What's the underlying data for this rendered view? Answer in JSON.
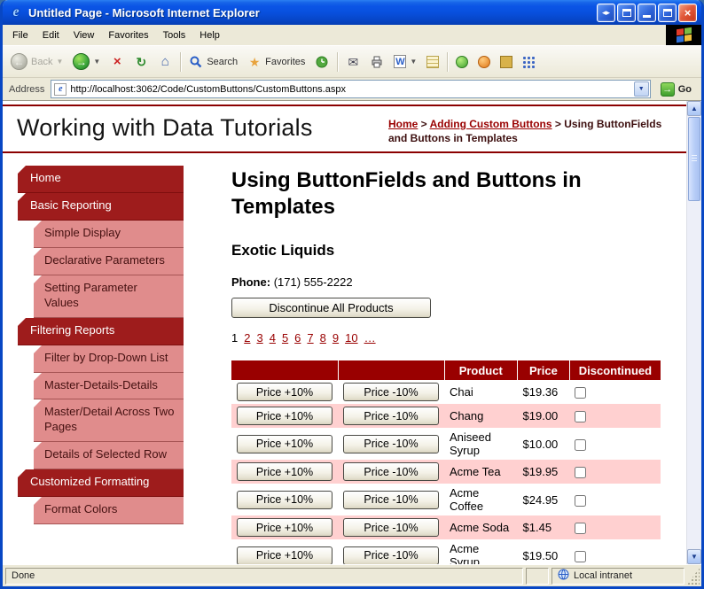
{
  "colors": {
    "maroon": "#990000",
    "nav_top_bg": "#9E1C1C",
    "nav_sub_bg": "#E08C8C",
    "row_alt": "#FFD0D0"
  },
  "window": {
    "title": "Untitled Page - Microsoft Internet Explorer",
    "menu": [
      "File",
      "Edit",
      "View",
      "Favorites",
      "Tools",
      "Help"
    ],
    "toolbar": {
      "back_label": "Back",
      "search_label": "Search",
      "favorites_label": "Favorites"
    },
    "address_label": "Address",
    "address_value": "http://localhost:3062/Code/CustomButtons/CustomButtons.aspx",
    "go_label": "Go",
    "status_left": "Done",
    "status_right": "Local intranet"
  },
  "page": {
    "site_title": "Working with Data Tutorials",
    "breadcrumb": [
      {
        "label": "Home",
        "link": true
      },
      {
        "label": "Adding Custom Buttons",
        "link": true
      },
      {
        "label": "Using ButtonFields and Buttons in Templates",
        "link": false
      }
    ],
    "sidebar": [
      {
        "label": "Home",
        "level": 1
      },
      {
        "label": "Basic Reporting",
        "level": 1
      },
      {
        "label": "Simple Display",
        "level": 2
      },
      {
        "label": "Declarative Parameters",
        "level": 2
      },
      {
        "label": "Setting Parameter Values",
        "level": 2
      },
      {
        "label": "Filtering Reports",
        "level": 1
      },
      {
        "label": "Filter by Drop-Down List",
        "level": 2
      },
      {
        "label": "Master-Details-Details",
        "level": 2
      },
      {
        "label": "Master/Detail Across Two Pages",
        "level": 2
      },
      {
        "label": "Details of Selected Row",
        "level": 2
      },
      {
        "label": "Customized Formatting",
        "level": 1
      },
      {
        "label": "Format Colors",
        "level": 2
      }
    ],
    "main": {
      "heading": "Using ButtonFields and Buttons in Templates",
      "supplier_name": "Exotic Liquids",
      "phone_label": "Phone:",
      "phone_value": "(171) 555-2222",
      "discontinue_button": "Discontinue All Products",
      "pager": [
        "1",
        "2",
        "3",
        "4",
        "5",
        "6",
        "7",
        "8",
        "9",
        "10",
        "…"
      ],
      "pager_current": "1",
      "table": {
        "headers": [
          "",
          "",
          "Product",
          "Price",
          "Discontinued"
        ],
        "increase_label": "Price +10%",
        "decrease_label": "Price -10%",
        "rows": [
          {
            "product": "Chai",
            "price": "$19.36"
          },
          {
            "product": "Chang",
            "price": "$19.00"
          },
          {
            "product": "Aniseed Syrup",
            "price": "$10.00"
          },
          {
            "product": "Acme Tea",
            "price": "$19.95"
          },
          {
            "product": "Acme Coffee",
            "price": "$24.95"
          },
          {
            "product": "Acme Soda",
            "price": "$1.45"
          },
          {
            "product": "Acme Syrup",
            "price": "$19.50"
          }
        ]
      }
    }
  }
}
